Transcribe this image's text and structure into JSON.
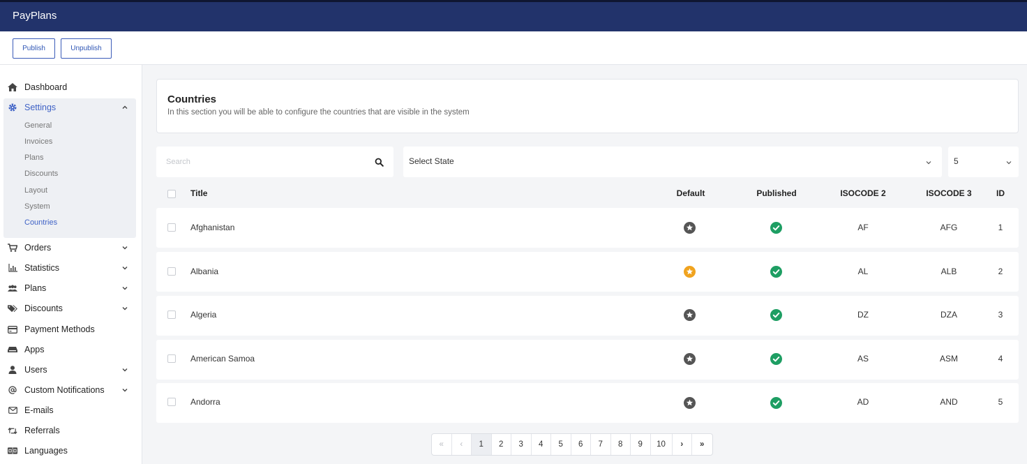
{
  "app": {
    "title": "PayPlans"
  },
  "toolbar": {
    "publish_label": "Publish",
    "unpublish_label": "Unpublish"
  },
  "sidebar": {
    "dashboard": "Dashboard",
    "settings": "Settings",
    "settings_sub": [
      "General",
      "Invoices",
      "Plans",
      "Discounts",
      "Layout",
      "System",
      "Countries"
    ],
    "orders": "Orders",
    "statistics": "Statistics",
    "plans": "Plans",
    "discounts": "Discounts",
    "payment_methods": "Payment Methods",
    "apps": "Apps",
    "users": "Users",
    "custom_notifications": "Custom Notifications",
    "emails": "E-mails",
    "referrals": "Referrals",
    "languages": "Languages"
  },
  "header": {
    "title": "Countries",
    "description": "In this section you will be able to configure the countries that are visible in the system"
  },
  "filters": {
    "search_placeholder": "Search",
    "state_select": "Select State",
    "page_size": "5"
  },
  "table": {
    "columns": {
      "title": "Title",
      "default": "Default",
      "published": "Published",
      "iso2": "ISOCODE 2",
      "iso3": "ISOCODE 3",
      "id": "ID"
    },
    "rows": [
      {
        "title": "Afghanistan",
        "default": false,
        "published": true,
        "iso2": "AF",
        "iso3": "AFG",
        "id": "1"
      },
      {
        "title": "Albania",
        "default": true,
        "published": true,
        "iso2": "AL",
        "iso3": "ALB",
        "id": "2"
      },
      {
        "title": "Algeria",
        "default": false,
        "published": true,
        "iso2": "DZ",
        "iso3": "DZA",
        "id": "3"
      },
      {
        "title": "American Samoa",
        "default": false,
        "published": true,
        "iso2": "AS",
        "iso3": "ASM",
        "id": "4"
      },
      {
        "title": "Andorra",
        "default": false,
        "published": true,
        "iso2": "AD",
        "iso3": "AND",
        "id": "5"
      }
    ]
  },
  "pagination": {
    "first": "«",
    "prev": "‹",
    "pages": [
      "1",
      "2",
      "3",
      "4",
      "5",
      "6",
      "7",
      "8",
      "9",
      "10"
    ],
    "next": "›",
    "last": "»",
    "current": "1"
  },
  "colors": {
    "topbar": "#22336b",
    "accent": "#3f62c6",
    "published": "#1e9e63",
    "default_star": "#f0a31f",
    "non_default_star": "#555555"
  }
}
